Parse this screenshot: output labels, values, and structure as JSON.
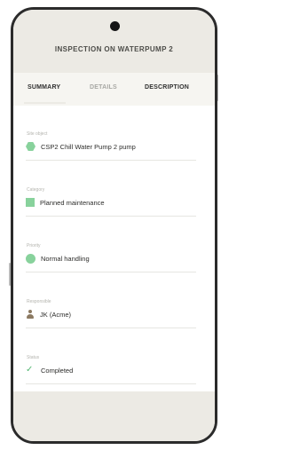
{
  "header": {
    "title": "INSPECTION ON WATERPUMP 2"
  },
  "tabs": [
    {
      "label": "SUMMARY",
      "active": true
    },
    {
      "label": "DETAILS",
      "active": false
    },
    {
      "label": "DESCRIPTION",
      "active": false
    }
  ],
  "fields": [
    {
      "label": "Site object",
      "value": "CSP2 Chill Water Pump 2 pump",
      "icon": "hexagon-icon"
    },
    {
      "label": "Category",
      "value": "Planned maintenance",
      "icon": "square-icon"
    },
    {
      "label": "Priority",
      "value": "Normal handling",
      "icon": "circle-icon"
    },
    {
      "label": "Responsible",
      "value": "JK (Acme)",
      "icon": "person-icon"
    },
    {
      "label": "Status",
      "value": "Completed",
      "icon": "checkmark-icon"
    }
  ],
  "colors": {
    "accent": "#88d29c",
    "header_bg": "#eceae4",
    "check": "#56b874",
    "person": "#8c7a62"
  }
}
